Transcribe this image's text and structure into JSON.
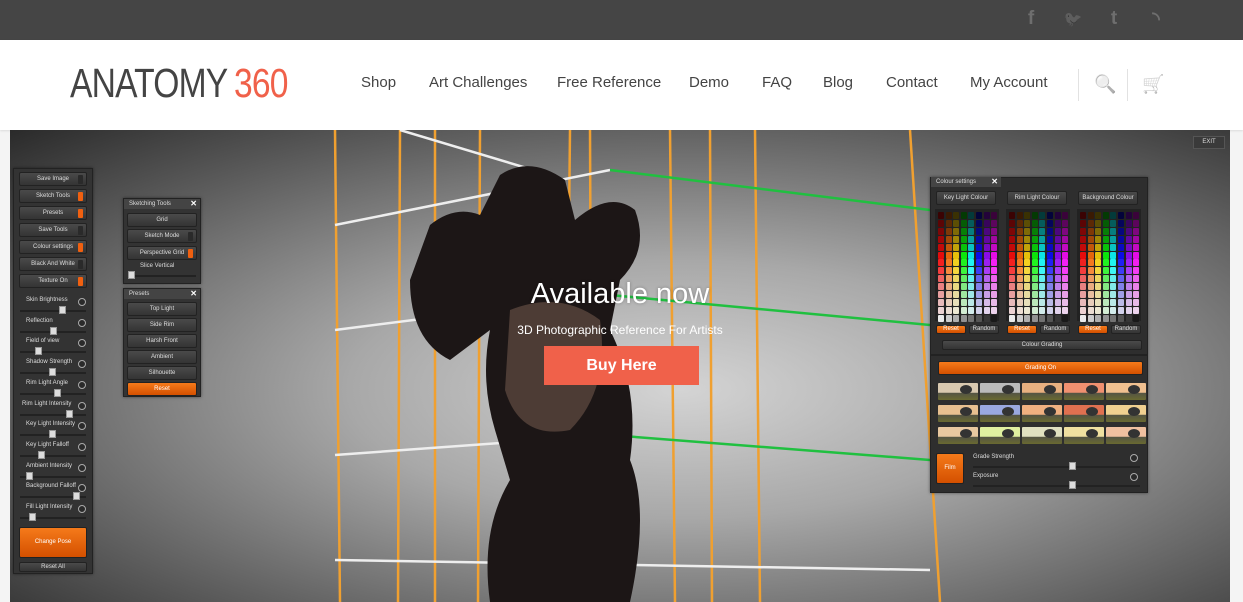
{
  "topbar": {
    "social": [
      {
        "icon": "facebook-icon",
        "glyph": "f"
      },
      {
        "icon": "twitter-icon",
        "glyph": "🐦"
      },
      {
        "icon": "tumblr-icon",
        "glyph": "t"
      },
      {
        "icon": "rss-icon",
        "glyph": "◝"
      }
    ]
  },
  "header": {
    "logo": {
      "part1": "ANATOMY",
      "part2": "360"
    },
    "nav": [
      "Shop",
      "Art Challenges",
      "Free Reference",
      "Demo",
      "FAQ",
      "Blog",
      "Contact",
      "My Account"
    ],
    "search_icon": "🔍",
    "cart_icon": "🛒"
  },
  "colors": {
    "brand": "#f0614a",
    "ui_orange": "#f06010",
    "topbar": "#454545"
  },
  "hero": {
    "title": "Available now",
    "subtitle": "3D Photographic Reference For Artists",
    "cta": "Buy Here",
    "exit": "EXIT"
  },
  "left_panel": {
    "buttons": [
      {
        "label": "Save Image",
        "on": false
      },
      {
        "label": "Sketch Tools",
        "on": true
      },
      {
        "label": "Presets",
        "on": true
      },
      {
        "label": "Save Tools",
        "on": false
      },
      {
        "label": "Colour settings",
        "on": true
      },
      {
        "label": "Black And White",
        "on": false
      },
      {
        "label": "Texture On",
        "on": true
      }
    ],
    "sliders": [
      {
        "label": "Skin Brightness",
        "value": 0.65
      },
      {
        "label": "Reflection",
        "value": 0.5
      },
      {
        "label": "Field of view",
        "value": 0.25
      },
      {
        "label": "Shadow Strength",
        "value": 0.48
      },
      {
        "label": "Rim Light Angle",
        "value": 0.56
      },
      {
        "label": "Rim Light Intensity",
        "value": 0.76
      },
      {
        "label": "Key Light Intensity",
        "value": 0.48
      },
      {
        "label": "Key Light Falloff",
        "value": 0.3
      },
      {
        "label": "Ambient Intensity",
        "value": 0.1
      },
      {
        "label": "Background Falloff",
        "value": 0.88
      },
      {
        "label": "Fill Light Intensity",
        "value": 0.15
      }
    ],
    "change_pose": "Change Pose",
    "reset_all": "Reset All"
  },
  "sketching_tools": {
    "title": "Sketching Tools",
    "buttons": [
      {
        "label": "Grid"
      },
      {
        "label": "Sketch Mode",
        "on": false
      },
      {
        "label": "Perspective Grid",
        "on": true
      }
    ],
    "slider": {
      "label": "Slice Vertical",
      "value": 0.0
    }
  },
  "presets": {
    "title": "Presets",
    "buttons": [
      "Top Light",
      "Side Rim",
      "Harsh Front",
      "Ambient",
      "Silhouette"
    ],
    "reset": "Reset"
  },
  "colour_settings": {
    "title": "Colour settings",
    "columns": [
      "Key Light Colour",
      "Rim Light Colour",
      "Background Colour"
    ],
    "reset": "Reset",
    "random": "Random",
    "grading_header": "Colour Grading",
    "grading_on": "Grading On",
    "film": "Film",
    "sliders": [
      {
        "label": "Grade Strength",
        "value": 0.6
      },
      {
        "label": "Exposure",
        "value": 0.6
      }
    ]
  }
}
